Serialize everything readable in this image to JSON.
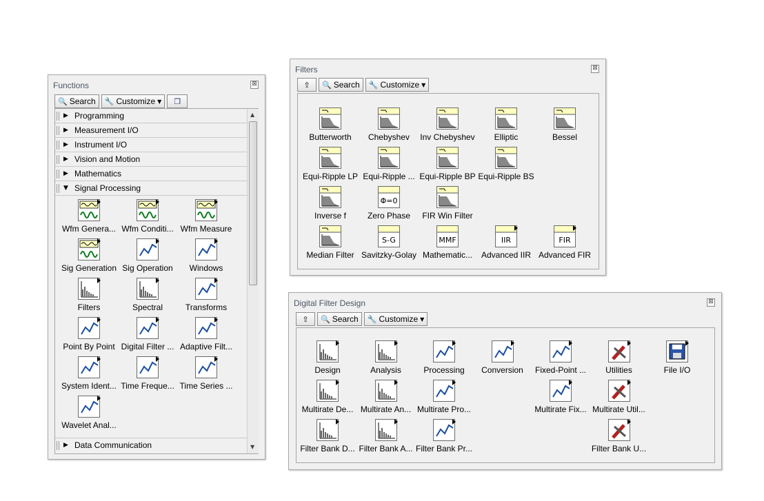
{
  "functions": {
    "title": "Functions",
    "close": "⊠",
    "search_label": "Search",
    "customize_label": "Customize",
    "categories_top": [
      "Programming",
      "Measurement I/O",
      "Instrument I/O",
      "Vision and Motion",
      "Mathematics"
    ],
    "expanded": "Signal Processing",
    "bottom": "Data Communication",
    "items": [
      {
        "label": "Wfm Genera...",
        "icon": "waveform-generation-icon"
      },
      {
        "label": "Wfm Conditi...",
        "icon": "waveform-conditioning-icon"
      },
      {
        "label": "Wfm Measure",
        "icon": "waveform-measure-icon"
      },
      {
        "label": "Sig Generation",
        "icon": "signal-generation-icon"
      },
      {
        "label": "Sig Operation",
        "icon": "signal-operation-icon"
      },
      {
        "label": "Windows",
        "icon": "windows-icon"
      },
      {
        "label": "Filters",
        "icon": "filters-icon"
      },
      {
        "label": "Spectral",
        "icon": "spectral-icon"
      },
      {
        "label": "Transforms",
        "icon": "transforms-icon"
      },
      {
        "label": "Point By Point",
        "icon": "point-by-point-icon"
      },
      {
        "label": "Digital Filter ...",
        "icon": "digital-filter-icon"
      },
      {
        "label": "Adaptive Filt...",
        "icon": "adaptive-filter-icon"
      },
      {
        "label": "System Ident...",
        "icon": "system-identification-icon"
      },
      {
        "label": "Time Freque...",
        "icon": "time-frequency-icon"
      },
      {
        "label": "Time Series ...",
        "icon": "time-series-icon"
      },
      {
        "label": "Wavelet Anal...",
        "icon": "wavelet-analysis-icon"
      }
    ]
  },
  "filters": {
    "title": "Filters",
    "close": "⊠",
    "search_label": "Search",
    "customize_label": "Customize",
    "items": [
      {
        "label": "Butterworth",
        "icon": "butterworth-icon"
      },
      {
        "label": "Chebyshev",
        "icon": "chebyshev-icon"
      },
      {
        "label": "Inv Chebyshev",
        "icon": "inv-chebyshev-icon"
      },
      {
        "label": "Elliptic",
        "icon": "elliptic-icon"
      },
      {
        "label": "Bessel",
        "icon": "bessel-icon"
      },
      {
        "label": "Equi-Ripple LP",
        "icon": "equi-ripple-lp-icon"
      },
      {
        "label": "Equi-Ripple ...",
        "icon": "equi-ripple-hp-icon"
      },
      {
        "label": "Equi-Ripple BP",
        "icon": "equi-ripple-bp-icon"
      },
      {
        "label": "Equi-Ripple BS",
        "icon": "equi-ripple-bs-icon"
      },
      {
        "label": "Inverse f",
        "icon": "inverse-f-icon"
      },
      {
        "label": "Zero Phase",
        "icon": "zero-phase-icon",
        "glyph": "Φ=0"
      },
      {
        "label": "FIR Win Filter",
        "icon": "fir-window-filter-icon"
      },
      {
        "label": "Median Filter",
        "icon": "median-filter-icon"
      },
      {
        "label": "Savitzky-Golay",
        "icon": "savitzky-golay-icon",
        "glyph": "S-G"
      },
      {
        "label": "Mathematic...",
        "icon": "mathematical-morphology-icon",
        "glyph": "MMF"
      },
      {
        "label": "Advanced IIR",
        "icon": "advanced-iir-icon",
        "glyph": "IIR"
      },
      {
        "label": "Advanced FIR",
        "icon": "advanced-fir-icon",
        "glyph": "FIR"
      }
    ]
  },
  "dfd": {
    "title": "Digital Filter Design",
    "close": "⊠",
    "search_label": "Search",
    "customize_label": "Customize",
    "items": [
      {
        "label": "Design",
        "icon": "design-icon"
      },
      {
        "label": "Analysis",
        "icon": "analysis-icon"
      },
      {
        "label": "Processing",
        "icon": "processing-icon"
      },
      {
        "label": "Conversion",
        "icon": "conversion-icon"
      },
      {
        "label": "Fixed-Point ...",
        "icon": "fixed-point-icon"
      },
      {
        "label": "Utilities",
        "icon": "utilities-icon"
      },
      {
        "label": "File I/O",
        "icon": "file-io-icon"
      },
      {
        "label": "Multirate De...",
        "icon": "multirate-design-icon"
      },
      {
        "label": "Multirate An...",
        "icon": "multirate-analysis-icon"
      },
      {
        "label": "Multirate Pro...",
        "icon": "multirate-processing-icon"
      },
      {
        "label": "Multirate Fix...",
        "icon": "multirate-fixed-point-icon"
      },
      {
        "label": "Multirate Util...",
        "icon": "multirate-utilities-icon"
      },
      {
        "label": "Filter Bank D...",
        "icon": "filter-bank-design-icon"
      },
      {
        "label": "Filter Bank A...",
        "icon": "filter-bank-analysis-icon"
      },
      {
        "label": "Filter Bank Pr...",
        "icon": "filter-bank-processing-icon"
      },
      {
        "label": "Filter Bank U...",
        "icon": "filter-bank-utilities-icon"
      }
    ]
  }
}
